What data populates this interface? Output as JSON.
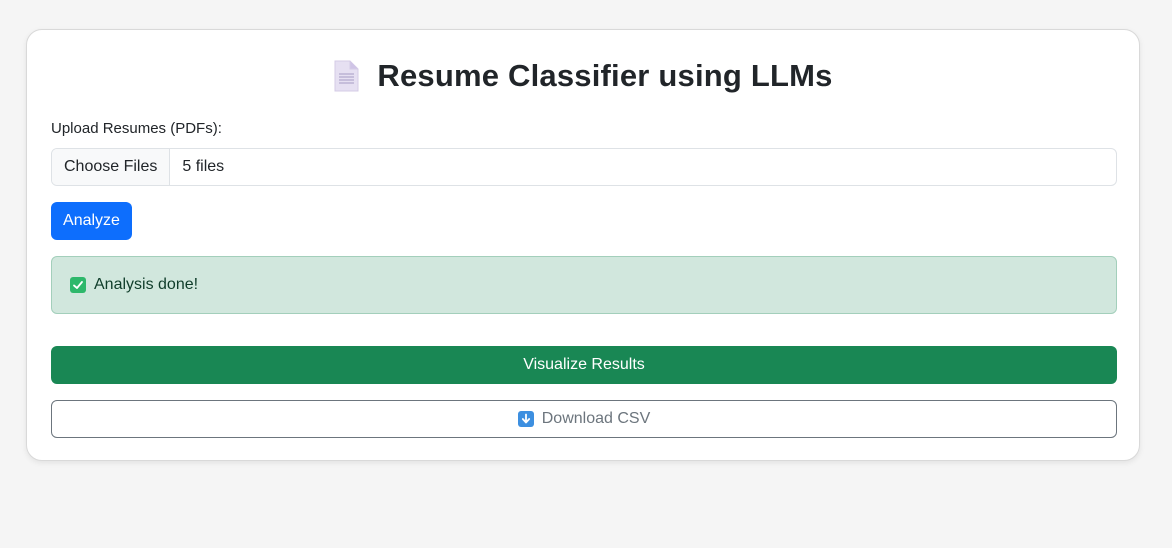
{
  "header": {
    "title": "Resume Classifier using LLMs",
    "icon": "document-icon"
  },
  "upload": {
    "label": "Upload Resumes (PDFs):",
    "choose_button": "Choose Files",
    "file_status": "5 files"
  },
  "actions": {
    "analyze_label": "Analyze",
    "visualize_label": "Visualize Results",
    "download_label": "Download CSV",
    "download_icon": "down-arrow-icon"
  },
  "alert": {
    "icon": "check-mark-icon",
    "message": "Analysis done!"
  },
  "colors": {
    "primary": "#0d6efd",
    "success": "#198754",
    "alert_bg": "#d1e7dd",
    "outline": "#6c757d"
  }
}
